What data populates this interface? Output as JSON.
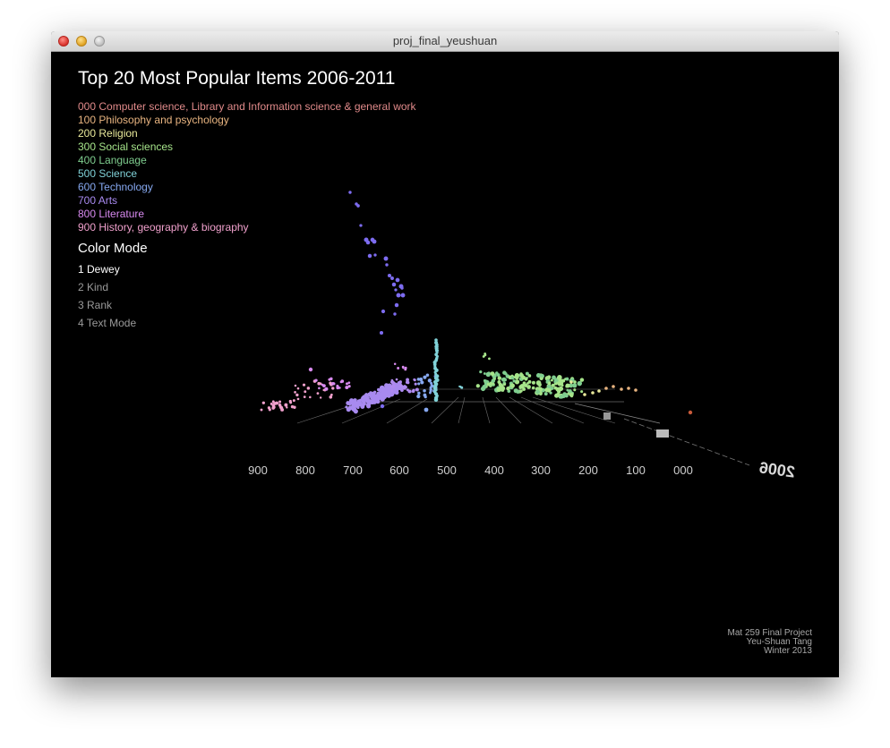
{
  "window": {
    "title": "proj_final_yeushuan",
    "controls": [
      "close-icon",
      "minimize-icon",
      "zoom-icon"
    ]
  },
  "page": {
    "title": "Top 20 Most Popular Items 2006-2011"
  },
  "legend": [
    {
      "label": "000 Computer science, Library and Information science & general work",
      "color": "#e08a8a"
    },
    {
      "label": "100 Philosophy and psychology",
      "color": "#e8b480"
    },
    {
      "label": "200 Religion",
      "color": "#e8e89a"
    },
    {
      "label": "300 Social sciences",
      "color": "#a6e48a"
    },
    {
      "label": "400 Language",
      "color": "#7fce8f"
    },
    {
      "label": "500 Science",
      "color": "#80d2d8"
    },
    {
      "label": "600 Technology",
      "color": "#86a8f0"
    },
    {
      "label": "700 Arts",
      "color": "#a88af0"
    },
    {
      "label": "800 Literature",
      "color": "#d88af0"
    },
    {
      "label": "900 History, geography & biography",
      "color": "#f0a0cc"
    }
  ],
  "color_mode": {
    "title": "Color Mode",
    "options": [
      {
        "label": "1 Dewey",
        "active": true
      },
      {
        "label": "2 Kind",
        "active": false
      },
      {
        "label": "3 Rank",
        "active": false
      },
      {
        "label": "4 Text Mode",
        "active": false
      }
    ]
  },
  "chart_data": {
    "type": "scatter",
    "title": "",
    "xlabel": "",
    "ylabel": "",
    "x_axis_ticks": [
      "900",
      "800",
      "700",
      "600",
      "500",
      "400",
      "300",
      "200",
      "100",
      "000"
    ],
    "depth_axis_label": "2006",
    "grid": true
  },
  "credits": {
    "line1": "Mat 259 Final Project",
    "line2": "Yeu-Shuan Tang",
    "line3": "Winter 2013"
  }
}
